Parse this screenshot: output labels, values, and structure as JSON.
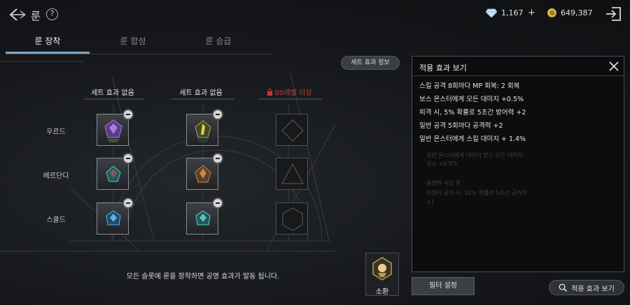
{
  "header": {
    "title": "룬",
    "help": "?",
    "gems": "1,167",
    "gold": "649,387",
    "gold_symbol": "G"
  },
  "tabs": [
    {
      "label": "룬 장착",
      "active": true
    },
    {
      "label": "룬 합성",
      "active": false
    },
    {
      "label": "룬 승급",
      "active": false
    }
  ],
  "set_info_button": "세트 효과 정보",
  "columns": [
    {
      "header": "세트 효과 없음",
      "locked": false
    },
    {
      "header": "세트 효과 없음",
      "locked": false
    },
    {
      "header": "00레벨 이상",
      "locked": true
    }
  ],
  "rows": [
    "우르드",
    "베르단디",
    "스쿨드"
  ],
  "bottom_message": "모든 슬롯에 룬을 장착하면 공명 효과가 발동 됩니다.",
  "summon_label": "소환",
  "effects_panel": {
    "title": "적용 효과 보기",
    "effects": [
      "스킬 공격 8회마다 MP 회복: 2 회복",
      "보스 몬스터에게  모든 대미지 +0.5%",
      "피격 시, 5% 확률로 5초간 방어력 +2",
      "일반 공격 5회마다 공격력 +2",
      "일반 몬스터에게  스킬 대미지 + 1.4%"
    ],
    "ghost_lines": [
      "일반 몬스터에게 대미지 받는 모든 대미지",
      "감소 +0.5%",
      "용맹한 사냥 룬",
      "치명타 공격 시, 10% 확률로 5초간 공격력",
      "+1"
    ]
  },
  "filter_button": "필터 설정",
  "view_effects_button": "적용 효과 보기",
  "colors": {
    "accent_tab": "#7fa6c9",
    "locked_red": "#c73a3a",
    "gold": "#e1b845"
  }
}
